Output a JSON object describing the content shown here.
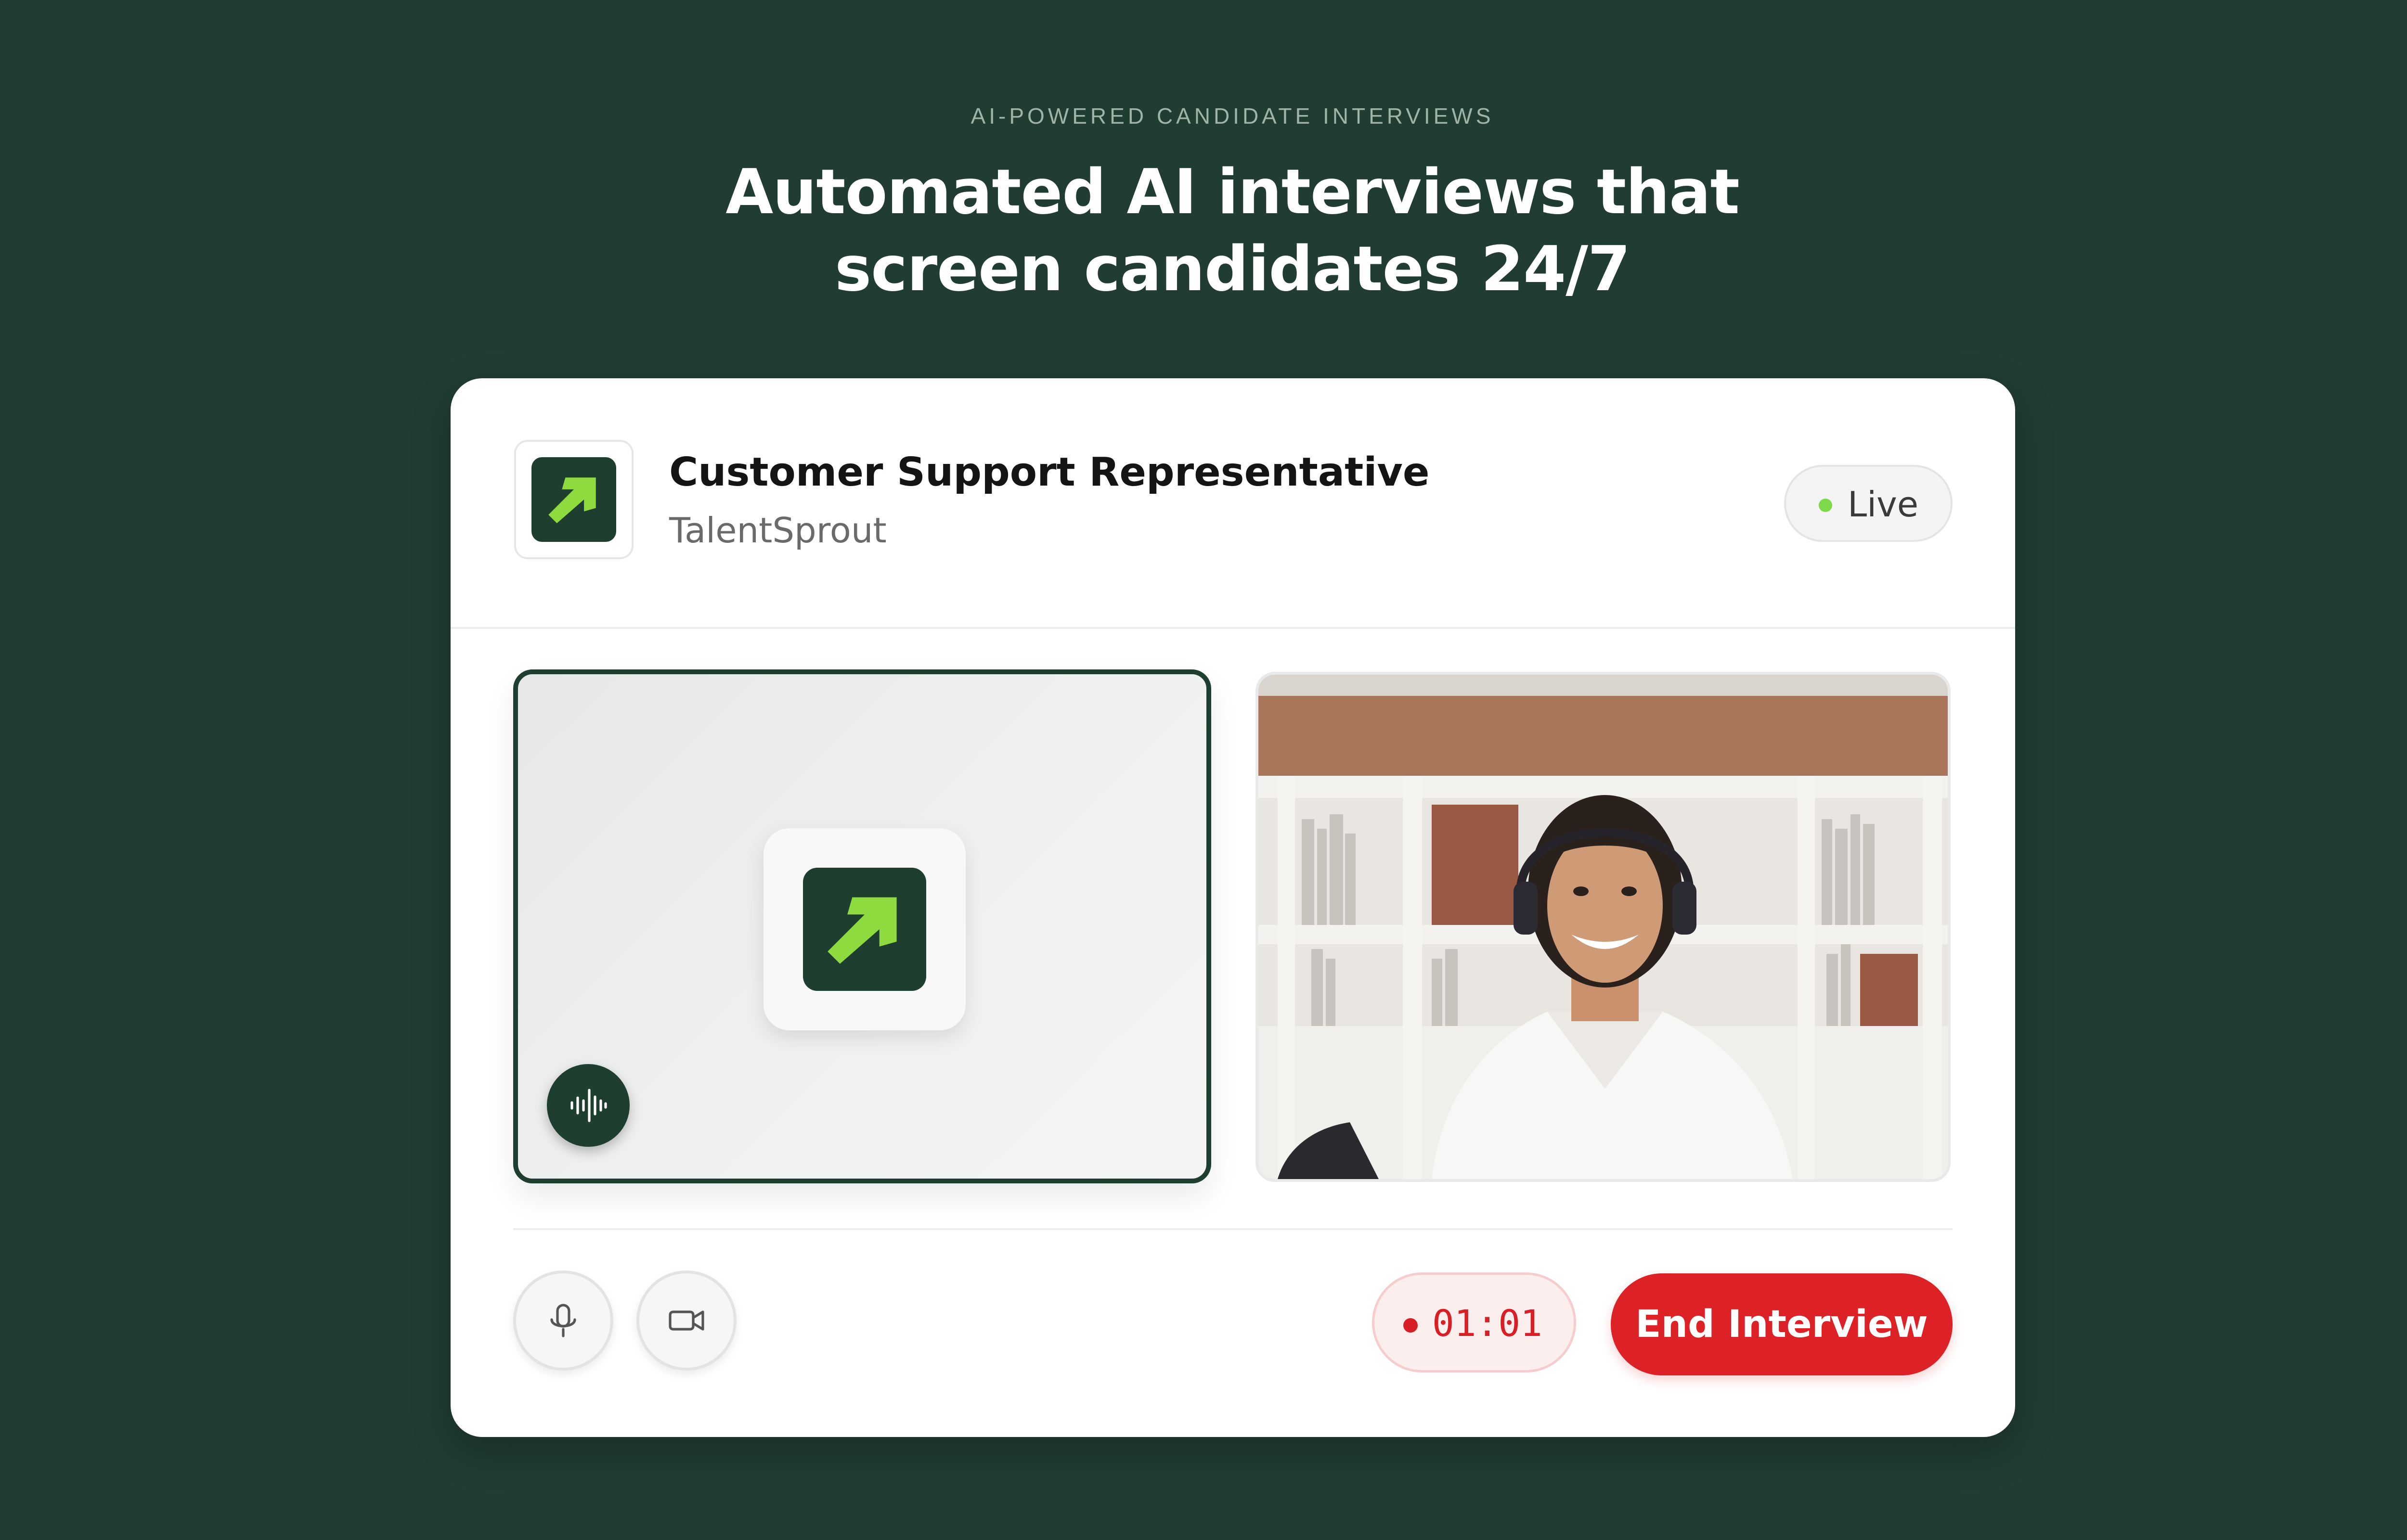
{
  "hero": {
    "eyebrow": "AI-POWERED CANDIDATE INTERVIEWS",
    "headline_line1": "Automated AI interviews that",
    "headline_line2": "screen candidates 24/7"
  },
  "interview": {
    "job_title": "Customer Support Representative",
    "company": "TalentSprout",
    "status": "Live",
    "timer": "01:01",
    "end_label": "End Interview"
  },
  "icons": {
    "logo": "arrow-up-right-logo-icon",
    "voice": "audio-waveform-icon",
    "mic": "microphone-icon",
    "camera": "video-camera-icon"
  },
  "colors": {
    "background": "#213d31",
    "brand_dark": "#1e3e30",
    "brand_accent": "#8edb3f",
    "live": "#7bd94a",
    "danger": "#dc2226"
  }
}
